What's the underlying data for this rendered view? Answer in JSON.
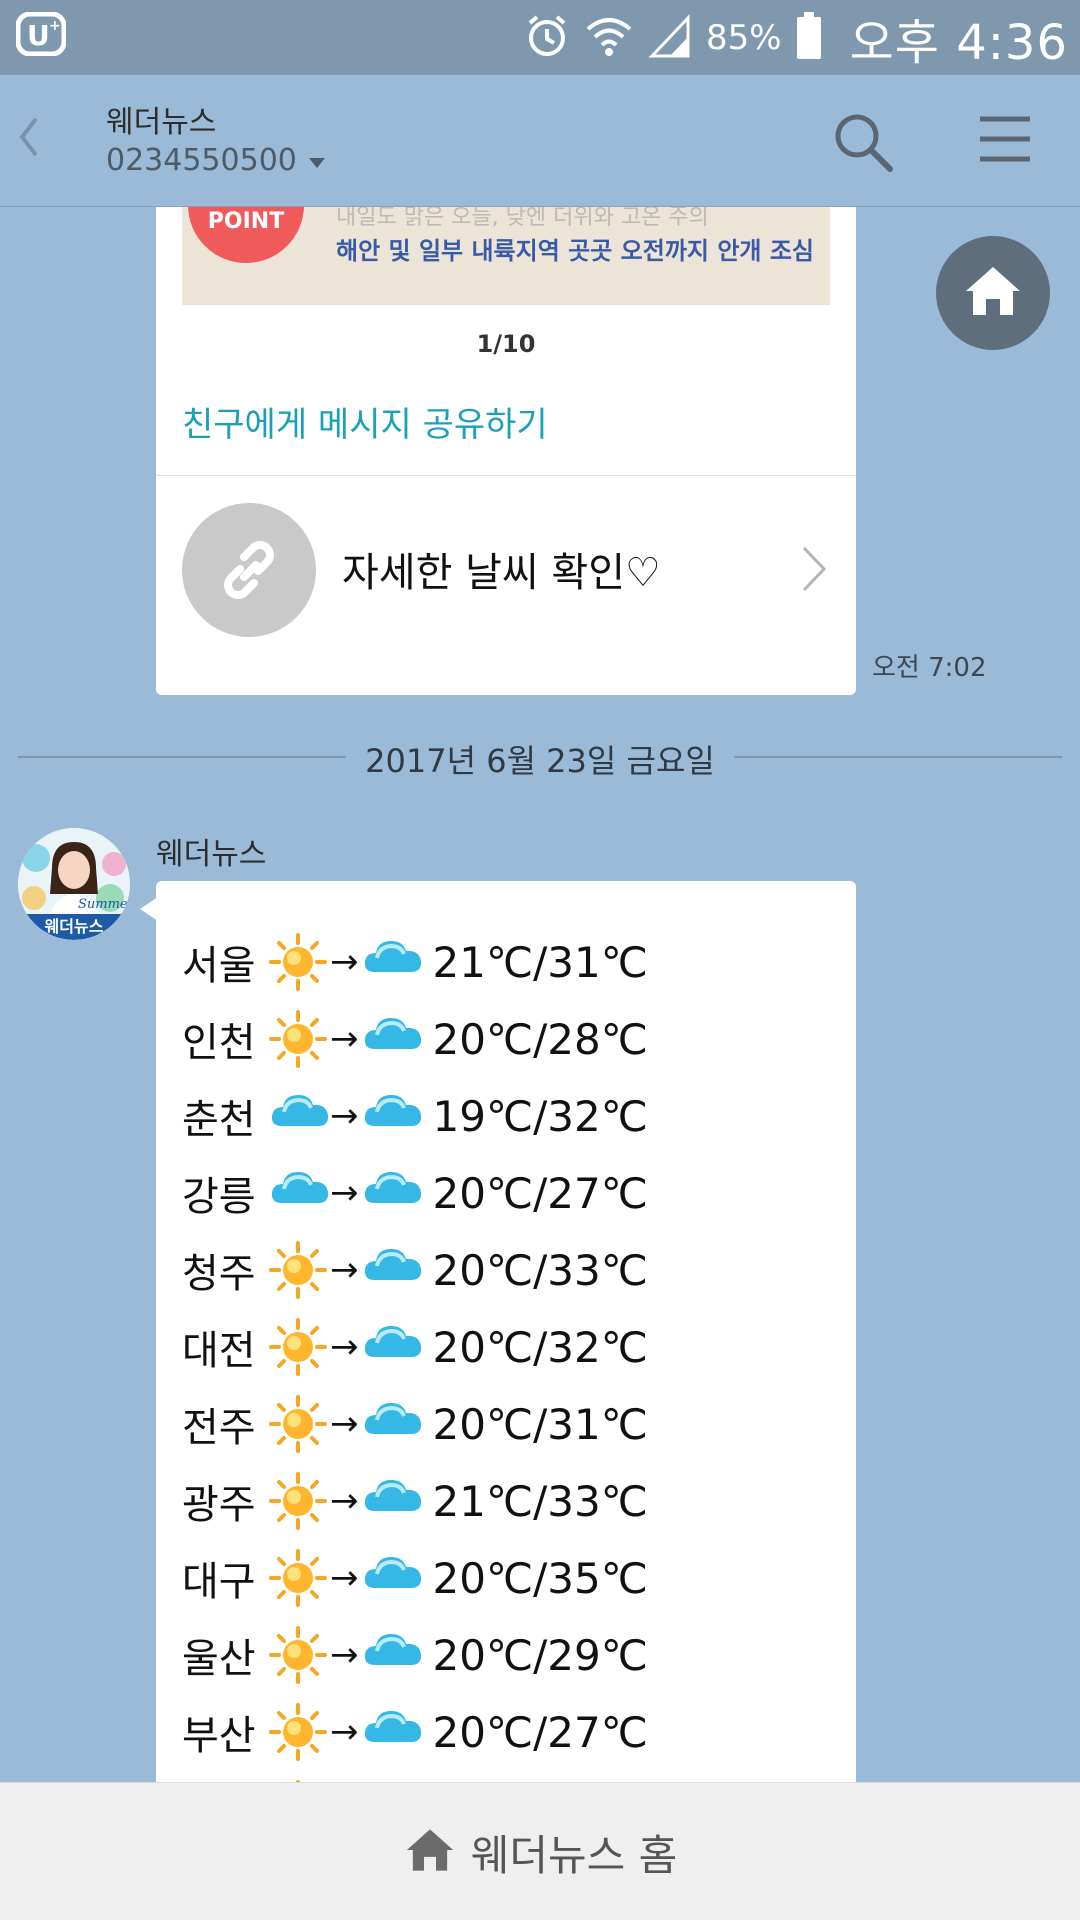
{
  "status_bar": {
    "carrier_icon": "lg-u-plus-icon",
    "icons": [
      "alarm-icon",
      "wifi-icon",
      "signal-icon"
    ],
    "battery_pct": "85%",
    "time": "오후 4:36"
  },
  "header": {
    "title": "웨더뉴스",
    "subtitle": "0234550500",
    "back_icon": "chevron-left-icon",
    "search_icon": "search-icon",
    "menu_icon": "hamburger-menu-icon"
  },
  "card": {
    "banner_badge": "POINT",
    "banner_line1": "내일도 맑은 오늘, 낮엔 더위와 고온 주의",
    "banner_line2": "해안 및 일부 내륙지역 곳곳 오전까지 안개 조심",
    "pager": "1/10",
    "share_link": "친구에게 메시지 공유하기",
    "link_label": "자세한 날씨 확인♡",
    "link_icon": "link-icon",
    "arrow_icon": "chevron-right-icon"
  },
  "message_time": "오전 7:02",
  "date_separator": "2017년 6월 23일 금요일",
  "sender": {
    "name": "웨더뉴스",
    "avatar_label": "웨더뉴스",
    "avatar_script": "Summer"
  },
  "weather": [
    {
      "city": "서울",
      "from": "sun-icon",
      "to": "cloud-icon",
      "temp": "21℃/31℃"
    },
    {
      "city": "인천",
      "from": "sun-icon",
      "to": "cloud-icon",
      "temp": "20℃/28℃"
    },
    {
      "city": "춘천",
      "from": "cloud-icon",
      "to": "cloud-icon",
      "temp": "19℃/32℃"
    },
    {
      "city": "강릉",
      "from": "cloud-icon",
      "to": "cloud-icon",
      "temp": "20℃/27℃"
    },
    {
      "city": "청주",
      "from": "sun-icon",
      "to": "cloud-icon",
      "temp": "20℃/33℃"
    },
    {
      "city": "대전",
      "from": "sun-icon",
      "to": "cloud-icon",
      "temp": "20℃/32℃"
    },
    {
      "city": "전주",
      "from": "sun-icon",
      "to": "cloud-icon",
      "temp": "20℃/31℃"
    },
    {
      "city": "광주",
      "from": "sun-icon",
      "to": "cloud-icon",
      "temp": "21℃/33℃"
    },
    {
      "city": "대구",
      "from": "sun-icon",
      "to": "cloud-icon",
      "temp": "20℃/35℃"
    },
    {
      "city": "울산",
      "from": "sun-icon",
      "to": "cloud-icon",
      "temp": "20℃/29℃"
    },
    {
      "city": "부산",
      "from": "sun-icon",
      "to": "cloud-icon",
      "temp": "20℃/27℃"
    }
  ],
  "arrow": "→",
  "bottom_bar": {
    "label": "웨더뉴스 홈",
    "icon": "home-icon"
  },
  "fab_icon": "home-icon",
  "colors": {
    "chat_bg": "#9bbad7",
    "status_bar": "#7f98ae",
    "share_link": "#1aa1b5",
    "point_badge": "#f05a5a"
  }
}
